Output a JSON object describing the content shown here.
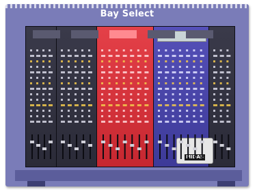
{
  "window": {
    "title": "Bay Select"
  },
  "console": {
    "logo": "MIDAS",
    "bays": [
      {
        "id": "bay-1",
        "color": "#34344a"
      },
      {
        "id": "bay-2",
        "color": "#34344a"
      },
      {
        "id": "bay-3",
        "color": "#d8323a",
        "selected": true
      },
      {
        "id": "bay-4",
        "color": "#4a46ac"
      },
      {
        "id": "bay-5",
        "color": "#34344a"
      }
    ]
  },
  "colors": {
    "frame": "#7a7cb8",
    "accent_red": "#d8323a",
    "accent_blue": "#4a46ac"
  }
}
